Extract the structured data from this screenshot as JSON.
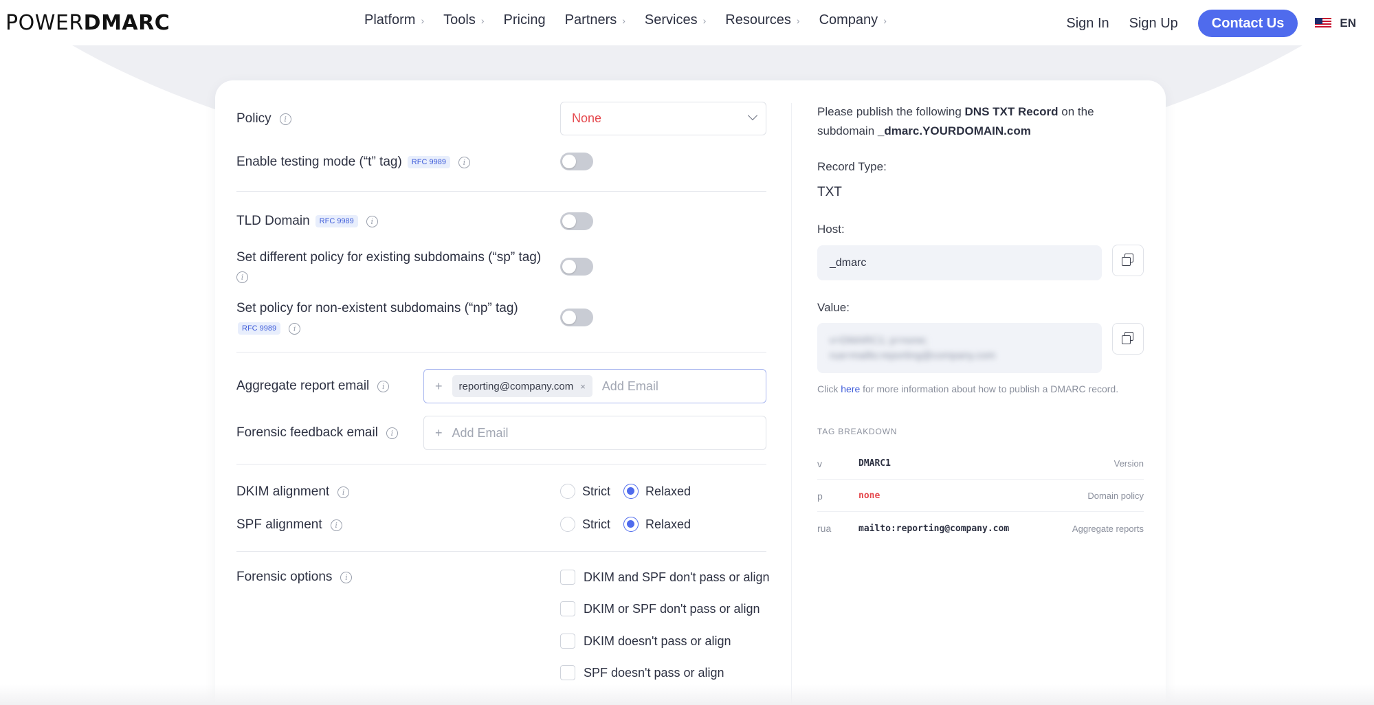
{
  "nav": {
    "logo_left": "POWER",
    "logo_right": "DMARC",
    "links": [
      "Platform",
      "Tools",
      "Pricing",
      "Partners",
      "Services",
      "Resources",
      "Company"
    ],
    "sign_in": "Sign In",
    "sign_up": "Sign Up",
    "contact": "Contact Us",
    "lang": "EN"
  },
  "form": {
    "policy_label": "Policy",
    "policy_value": "None",
    "testing_label": "Enable testing mode (“t” tag)",
    "rfc": "RFC 9989",
    "tld_label": "TLD Domain",
    "sp_label": "Set different policy for existing subdomains (“sp” tag)",
    "np_label": "Set policy for non-existent subdomains (“np” tag)",
    "aggregate_label": "Aggregate report email",
    "aggregate_chip": "reporting@company.com",
    "add_email_placeholder": "Add Email",
    "forensic_label": "Forensic feedback email",
    "dkim_label": "DKIM alignment",
    "spf_label": "SPF alignment",
    "strict": "Strict",
    "relaxed": "Relaxed",
    "forensic_options_label": "Forensic options",
    "forensic_options": [
      "DKIM and SPF don't pass or align",
      "DKIM or SPF don't pass or align",
      "DKIM doesn't pass or align",
      "SPF doesn't pass or align"
    ]
  },
  "record": {
    "intro_1": "Please publish the following ",
    "intro_bold": "DNS TXT Record",
    "intro_2": " on the",
    "intro_3": "subdomain ",
    "intro_sub": "_dmarc.YOURDOMAIN.com",
    "type_label": "Record Type:",
    "type_value": "TXT",
    "host_label": "Host:",
    "host_value": "_dmarc",
    "value_label": "Value:",
    "value_value": "v=DMARC1; p=none; rua=mailto:reporting@company.com",
    "help_1": "Click ",
    "help_link": "here",
    "help_2": " for more information about how to publish a DMARC record.",
    "tag_breakdown": "TAG BREAKDOWN",
    "tags": [
      {
        "k": "v",
        "v": "DMARC1",
        "d": "Version"
      },
      {
        "k": "p",
        "v": "none",
        "d": "Domain policy"
      },
      {
        "k": "rua",
        "v": "mailto:reporting@company.com",
        "d": "Aggregate reports"
      }
    ]
  },
  "colors": {
    "accent": "#4f6bed",
    "danger": "#e5484d"
  }
}
